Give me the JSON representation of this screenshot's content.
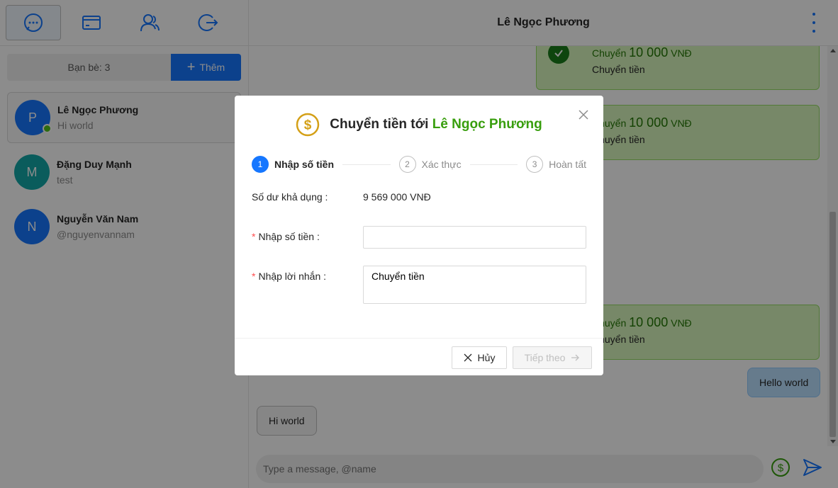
{
  "nav": {
    "items": [
      {
        "name": "messages",
        "icon": "chat-bubble-icon",
        "active": true
      },
      {
        "name": "wallet",
        "icon": "wallet-icon",
        "active": false
      },
      {
        "name": "friends",
        "icon": "users-icon",
        "active": false
      },
      {
        "name": "logout",
        "icon": "logout-icon",
        "active": false
      }
    ]
  },
  "friends_bar": {
    "count_label": "Bạn bè: 3",
    "add_label": "Thêm"
  },
  "contacts": [
    {
      "initial": "P",
      "name": "Lê Ngọc Phương",
      "sub": "Hi world",
      "color": "#1677ff",
      "online": true
    },
    {
      "initial": "M",
      "name": "Đặng Duy Mạnh",
      "sub": "test",
      "color": "#13a8a8",
      "online": false
    },
    {
      "initial": "N",
      "name": "Nguyễn Văn Nam",
      "sub": "@nguyenvannam",
      "color": "#1677ff",
      "online": false
    }
  ],
  "chat": {
    "title": "Lê Ngọc Phương",
    "transfers": [
      {
        "prefix": "Chuyển",
        "amount": "10 000",
        "currency": "VNĐ",
        "note": "Chuyển tiền"
      },
      {
        "prefix": "Chuyển",
        "amount": "10 000",
        "currency": "VNĐ",
        "note": "Chuyển tiền"
      },
      {
        "prefix": "Chuyển",
        "amount": "10 000",
        "currency": "VNĐ",
        "note": "Chuyển tiền"
      }
    ],
    "outgoing_message": "Hello world",
    "incoming_message": "Hi world",
    "composer_placeholder": "Type a message, @name"
  },
  "modal": {
    "title_prefix": "Chuyển tiền tới",
    "title_name": "Lê Ngọc Phương",
    "steps": [
      {
        "num": "1",
        "label": "Nhập số tiền",
        "active": true
      },
      {
        "num": "2",
        "label": "Xác thực",
        "active": false
      },
      {
        "num": "3",
        "label": "Hoàn tất",
        "active": false
      }
    ],
    "balance_label": "Số dư khả dụng",
    "balance_value": "9 569 000 VNĐ",
    "amount_label": "Nhập số tiền",
    "amount_value": "",
    "message_label": "Nhập lời nhắn",
    "message_value": "Chuyển tiền",
    "cancel_label": "Hủy",
    "next_label": "Tiếp theo"
  },
  "colors": {
    "primary": "#1677ff",
    "success": "#389e0d",
    "transfer_bg": "#d9f7be"
  }
}
